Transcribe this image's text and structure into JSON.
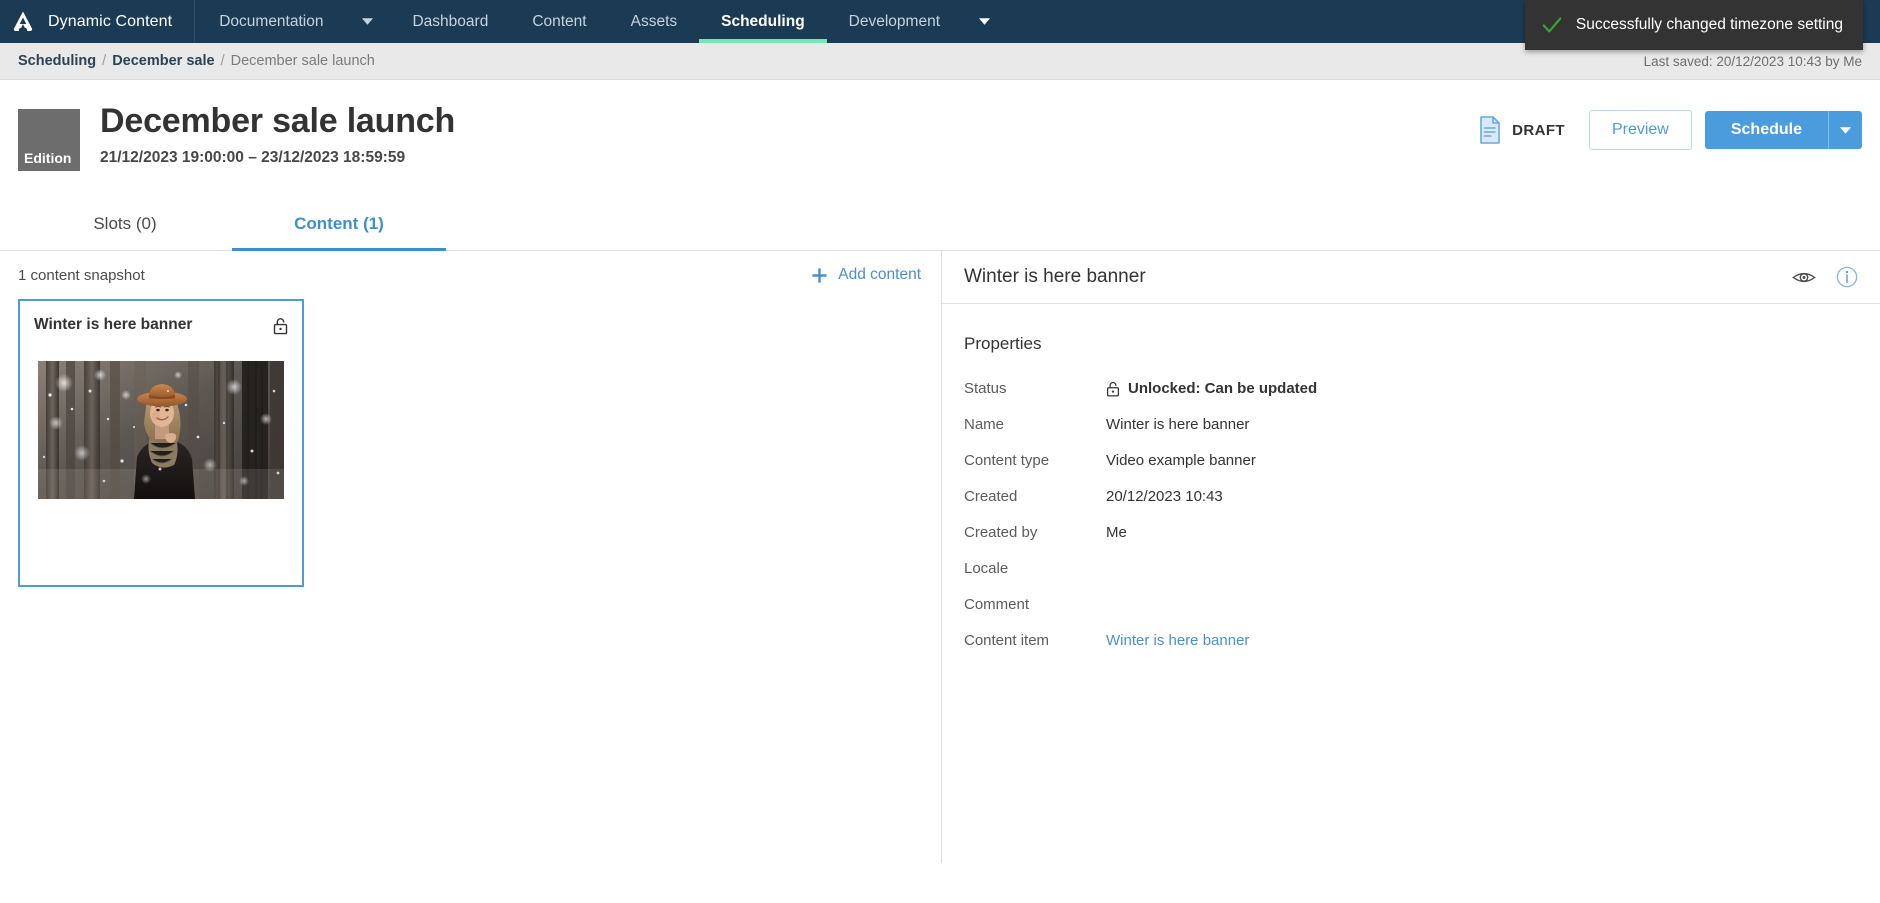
{
  "topnav": {
    "brand": "Dynamic Content",
    "logo_icon": "amplience-logo-icon",
    "items": [
      {
        "label": "Documentation",
        "active": false,
        "has_caret": true
      },
      {
        "label": "Dashboard",
        "active": false,
        "has_caret": false
      },
      {
        "label": "Content",
        "active": false,
        "has_caret": false
      },
      {
        "label": "Assets",
        "active": false,
        "has_caret": false
      },
      {
        "label": "Scheduling",
        "active": true,
        "has_caret": false
      },
      {
        "label": "Development",
        "active": false,
        "has_caret": true
      }
    ]
  },
  "toast": {
    "message": "Successfully changed timezone setting",
    "icon": "check-icon",
    "background": "#333333",
    "icon_color": "#37a534"
  },
  "breadcrumb": {
    "items": [
      {
        "label": "Scheduling",
        "current": false
      },
      {
        "label": "December sale",
        "current": false
      },
      {
        "label": "December sale launch",
        "current": true
      }
    ],
    "separator": "/",
    "last_saved": "Last saved: 20/12/2023 10:43 by Me"
  },
  "header": {
    "badge": "Edition",
    "title": "December sale launch",
    "dates": "21/12/2023 19:00:00  –  23/12/2023 18:59:59",
    "status_label": "DRAFT",
    "status_icon": "document-icon",
    "preview_label": "Preview",
    "schedule_label": "Schedule",
    "schedule_caret_icon": "chevron-down-icon",
    "accent_color": "#4a9cdc"
  },
  "tabs": [
    {
      "label": "Slots (0)",
      "active": false
    },
    {
      "label": "Content (1)",
      "active": true
    }
  ],
  "left_pane": {
    "snapshot_count": "1 content snapshot",
    "add_content_label": "Add content",
    "add_content_icon": "plus-icon",
    "card": {
      "title": "Winter is here banner",
      "lock_icon": "lock-open-icon",
      "image_alt": "Woman in hat smiling in snowy forest"
    }
  },
  "right_pane": {
    "title": "Winter is here banner",
    "eye_icon": "eye-icon",
    "info_icon": "info-icon",
    "section_title": "Properties",
    "properties": [
      {
        "label": "Status",
        "value": "Unlocked: Can be updated",
        "bold": true,
        "icon": "lock-open-icon",
        "link": false
      },
      {
        "label": "Name",
        "value": "Winter is here banner",
        "bold": false,
        "icon": null,
        "link": false
      },
      {
        "label": "Content type",
        "value": "Video example banner",
        "bold": false,
        "icon": null,
        "link": false
      },
      {
        "label": "Created",
        "value": "20/12/2023 10:43",
        "bold": false,
        "icon": null,
        "link": false
      },
      {
        "label": "Created by",
        "value": "Me",
        "bold": false,
        "icon": null,
        "link": false
      },
      {
        "label": "Locale",
        "value": "",
        "bold": false,
        "icon": null,
        "link": false
      },
      {
        "label": "Comment",
        "value": "",
        "bold": false,
        "icon": null,
        "link": false
      },
      {
        "label": "Content item",
        "value": "Winter is here banner",
        "bold": false,
        "icon": null,
        "link": true
      }
    ]
  }
}
